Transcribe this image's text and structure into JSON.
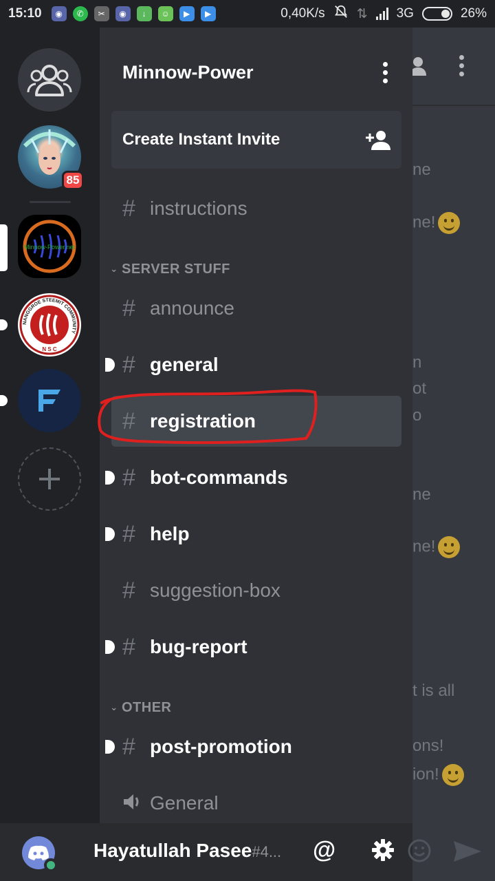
{
  "status_bar": {
    "time": "15:10",
    "net_speed": "0,40K/s",
    "network": "3G",
    "battery": "26%"
  },
  "guilds": {
    "unread_badge": "85",
    "minnow_logo_text": "Minnow-Power.net",
    "nsc_ring_text": "NANGGROE STEEMIT COMMUNITY",
    "nsc_initials": "N S C"
  },
  "server": {
    "name": "Minnow-Power",
    "invite_label": "Create Instant Invite"
  },
  "channels_top": [
    {
      "hash": "#",
      "name": "instructions"
    }
  ],
  "categories": {
    "server_stuff": "SERVER STUFF",
    "other": "OTHER"
  },
  "channels_server_stuff": [
    {
      "hash": "#",
      "name": "announce"
    },
    {
      "hash": "#",
      "name": "general"
    },
    {
      "hash": "#",
      "name": "registration"
    },
    {
      "hash": "#",
      "name": "bot-commands"
    },
    {
      "hash": "#",
      "name": "help"
    },
    {
      "hash": "#",
      "name": "suggestion-box"
    },
    {
      "hash": "#",
      "name": "bug-report"
    }
  ],
  "channels_other": [
    {
      "hash": "#",
      "name": "post-promotion"
    },
    {
      "name": "General"
    }
  ],
  "chat_peek": [
    "ne",
    "ne!",
    "n",
    "ot",
    "o",
    "ne",
    "ne!",
    "t is all",
    "ons!",
    "ion!"
  ],
  "user": {
    "name": "Hayatullah Pasee",
    "discriminator": "#4...",
    "at_symbol": "@"
  },
  "colors": {
    "accent": "#7289da",
    "highlight": "#e0201f",
    "online": "#43b581",
    "badge": "#f04747"
  }
}
